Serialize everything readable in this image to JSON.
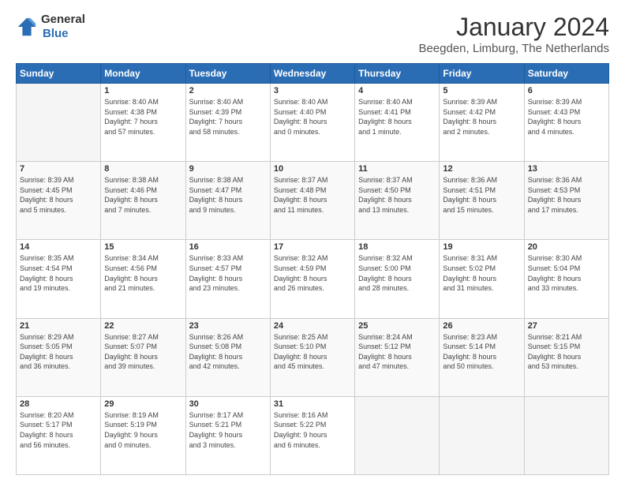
{
  "logo": {
    "general": "General",
    "blue": "Blue"
  },
  "header": {
    "month": "January 2024",
    "location": "Beegden, Limburg, The Netherlands"
  },
  "weekdays": [
    "Sunday",
    "Monday",
    "Tuesday",
    "Wednesday",
    "Thursday",
    "Friday",
    "Saturday"
  ],
  "weeks": [
    [
      {
        "day": "",
        "info": ""
      },
      {
        "day": "1",
        "info": "Sunrise: 8:40 AM\nSunset: 4:38 PM\nDaylight: 7 hours\nand 57 minutes."
      },
      {
        "day": "2",
        "info": "Sunrise: 8:40 AM\nSunset: 4:39 PM\nDaylight: 7 hours\nand 58 minutes."
      },
      {
        "day": "3",
        "info": "Sunrise: 8:40 AM\nSunset: 4:40 PM\nDaylight: 8 hours\nand 0 minutes."
      },
      {
        "day": "4",
        "info": "Sunrise: 8:40 AM\nSunset: 4:41 PM\nDaylight: 8 hours\nand 1 minute."
      },
      {
        "day": "5",
        "info": "Sunrise: 8:39 AM\nSunset: 4:42 PM\nDaylight: 8 hours\nand 2 minutes."
      },
      {
        "day": "6",
        "info": "Sunrise: 8:39 AM\nSunset: 4:43 PM\nDaylight: 8 hours\nand 4 minutes."
      }
    ],
    [
      {
        "day": "7",
        "info": "Sunrise: 8:39 AM\nSunset: 4:45 PM\nDaylight: 8 hours\nand 5 minutes."
      },
      {
        "day": "8",
        "info": "Sunrise: 8:38 AM\nSunset: 4:46 PM\nDaylight: 8 hours\nand 7 minutes."
      },
      {
        "day": "9",
        "info": "Sunrise: 8:38 AM\nSunset: 4:47 PM\nDaylight: 8 hours\nand 9 minutes."
      },
      {
        "day": "10",
        "info": "Sunrise: 8:37 AM\nSunset: 4:48 PM\nDaylight: 8 hours\nand 11 minutes."
      },
      {
        "day": "11",
        "info": "Sunrise: 8:37 AM\nSunset: 4:50 PM\nDaylight: 8 hours\nand 13 minutes."
      },
      {
        "day": "12",
        "info": "Sunrise: 8:36 AM\nSunset: 4:51 PM\nDaylight: 8 hours\nand 15 minutes."
      },
      {
        "day": "13",
        "info": "Sunrise: 8:36 AM\nSunset: 4:53 PM\nDaylight: 8 hours\nand 17 minutes."
      }
    ],
    [
      {
        "day": "14",
        "info": "Sunrise: 8:35 AM\nSunset: 4:54 PM\nDaylight: 8 hours\nand 19 minutes."
      },
      {
        "day": "15",
        "info": "Sunrise: 8:34 AM\nSunset: 4:56 PM\nDaylight: 8 hours\nand 21 minutes."
      },
      {
        "day": "16",
        "info": "Sunrise: 8:33 AM\nSunset: 4:57 PM\nDaylight: 8 hours\nand 23 minutes."
      },
      {
        "day": "17",
        "info": "Sunrise: 8:32 AM\nSunset: 4:59 PM\nDaylight: 8 hours\nand 26 minutes."
      },
      {
        "day": "18",
        "info": "Sunrise: 8:32 AM\nSunset: 5:00 PM\nDaylight: 8 hours\nand 28 minutes."
      },
      {
        "day": "19",
        "info": "Sunrise: 8:31 AM\nSunset: 5:02 PM\nDaylight: 8 hours\nand 31 minutes."
      },
      {
        "day": "20",
        "info": "Sunrise: 8:30 AM\nSunset: 5:04 PM\nDaylight: 8 hours\nand 33 minutes."
      }
    ],
    [
      {
        "day": "21",
        "info": "Sunrise: 8:29 AM\nSunset: 5:05 PM\nDaylight: 8 hours\nand 36 minutes."
      },
      {
        "day": "22",
        "info": "Sunrise: 8:27 AM\nSunset: 5:07 PM\nDaylight: 8 hours\nand 39 minutes."
      },
      {
        "day": "23",
        "info": "Sunrise: 8:26 AM\nSunset: 5:08 PM\nDaylight: 8 hours\nand 42 minutes."
      },
      {
        "day": "24",
        "info": "Sunrise: 8:25 AM\nSunset: 5:10 PM\nDaylight: 8 hours\nand 45 minutes."
      },
      {
        "day": "25",
        "info": "Sunrise: 8:24 AM\nSunset: 5:12 PM\nDaylight: 8 hours\nand 47 minutes."
      },
      {
        "day": "26",
        "info": "Sunrise: 8:23 AM\nSunset: 5:14 PM\nDaylight: 8 hours\nand 50 minutes."
      },
      {
        "day": "27",
        "info": "Sunrise: 8:21 AM\nSunset: 5:15 PM\nDaylight: 8 hours\nand 53 minutes."
      }
    ],
    [
      {
        "day": "28",
        "info": "Sunrise: 8:20 AM\nSunset: 5:17 PM\nDaylight: 8 hours\nand 56 minutes."
      },
      {
        "day": "29",
        "info": "Sunrise: 8:19 AM\nSunset: 5:19 PM\nDaylight: 9 hours\nand 0 minutes."
      },
      {
        "day": "30",
        "info": "Sunrise: 8:17 AM\nSunset: 5:21 PM\nDaylight: 9 hours\nand 3 minutes."
      },
      {
        "day": "31",
        "info": "Sunrise: 8:16 AM\nSunset: 5:22 PM\nDaylight: 9 hours\nand 6 minutes."
      },
      {
        "day": "",
        "info": ""
      },
      {
        "day": "",
        "info": ""
      },
      {
        "day": "",
        "info": ""
      }
    ]
  ]
}
